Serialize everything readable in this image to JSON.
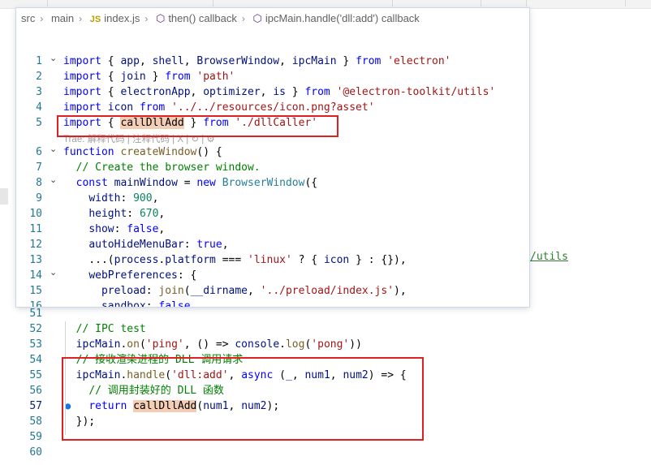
{
  "breadcrumb": {
    "items": [
      "src",
      "main",
      "index.js",
      "then() callback",
      "ipcMain.handle('dll:add') callback"
    ],
    "file_icon": "JS"
  },
  "hover_lines": [
    {
      "num": "1",
      "fold": true,
      "tokens": [
        [
          "k",
          "import"
        ],
        [
          "p",
          " { "
        ],
        [
          "v",
          "app"
        ],
        [
          "p",
          ", "
        ],
        [
          "v",
          "shell"
        ],
        [
          "p",
          ", "
        ],
        [
          "v",
          "BrowserWindow"
        ],
        [
          "p",
          ", "
        ],
        [
          "v",
          "ipcMain"
        ],
        [
          "p",
          " } "
        ],
        [
          "k",
          "from"
        ],
        [
          "p",
          " "
        ],
        [
          "s",
          "'electron'"
        ]
      ]
    },
    {
      "num": "2",
      "fold": false,
      "tokens": [
        [
          "k",
          "import"
        ],
        [
          "p",
          " { "
        ],
        [
          "v",
          "join"
        ],
        [
          "p",
          " } "
        ],
        [
          "k",
          "from"
        ],
        [
          "p",
          " "
        ],
        [
          "s",
          "'path'"
        ]
      ]
    },
    {
      "num": "3",
      "fold": false,
      "tokens": [
        [
          "k",
          "import"
        ],
        [
          "p",
          " { "
        ],
        [
          "v",
          "electronApp"
        ],
        [
          "p",
          ", "
        ],
        [
          "v",
          "optimizer"
        ],
        [
          "p",
          ", "
        ],
        [
          "v",
          "is"
        ],
        [
          "p",
          " } "
        ],
        [
          "k",
          "from"
        ],
        [
          "p",
          " "
        ],
        [
          "s",
          "'@electron-toolkit/utils'"
        ]
      ]
    },
    {
      "num": "4",
      "fold": false,
      "tokens": [
        [
          "k",
          "import"
        ],
        [
          "p",
          " "
        ],
        [
          "v",
          "icon"
        ],
        [
          "p",
          " "
        ],
        [
          "k",
          "from"
        ],
        [
          "p",
          " "
        ],
        [
          "s",
          "'../../resources/icon.png?asset'"
        ]
      ]
    },
    {
      "num": "5",
      "fold": false,
      "tokens": [
        [
          "k",
          "import"
        ],
        [
          "p",
          " { "
        ],
        [
          "hl",
          "callDllAdd"
        ],
        [
          "p",
          " } "
        ],
        [
          "k",
          "from"
        ],
        [
          "p",
          " "
        ],
        [
          "s",
          "'./dllCaller'"
        ]
      ]
    },
    {
      "num": "6",
      "fold": true,
      "tokens": [
        [
          "k",
          "function"
        ],
        [
          "p",
          " "
        ],
        [
          "f",
          "createWindow"
        ],
        [
          "p",
          "() {"
        ]
      ]
    },
    {
      "num": "7",
      "fold": false,
      "tokens": [
        [
          "p",
          "  "
        ],
        [
          "c",
          "// Create the browser window."
        ]
      ]
    },
    {
      "num": "8",
      "fold": true,
      "tokens": [
        [
          "p",
          "  "
        ],
        [
          "k",
          "const"
        ],
        [
          "p",
          " "
        ],
        [
          "v",
          "mainWindow"
        ],
        [
          "p",
          " = "
        ],
        [
          "k",
          "new"
        ],
        [
          "p",
          " "
        ],
        [
          "t",
          "BrowserWindow"
        ],
        [
          "p",
          "({"
        ]
      ]
    },
    {
      "num": "9",
      "fold": false,
      "tokens": [
        [
          "p",
          "    "
        ],
        [
          "v",
          "width"
        ],
        [
          "p",
          ": "
        ],
        [
          "n",
          "900"
        ],
        [
          "p",
          ","
        ]
      ]
    },
    {
      "num": "10",
      "fold": false,
      "tokens": [
        [
          "p",
          "    "
        ],
        [
          "v",
          "height"
        ],
        [
          "p",
          ": "
        ],
        [
          "n",
          "670"
        ],
        [
          "p",
          ","
        ]
      ]
    },
    {
      "num": "11",
      "fold": false,
      "tokens": [
        [
          "p",
          "    "
        ],
        [
          "v",
          "show"
        ],
        [
          "p",
          ": "
        ],
        [
          "k",
          "false"
        ],
        [
          "p",
          ","
        ]
      ]
    },
    {
      "num": "12",
      "fold": false,
      "tokens": [
        [
          "p",
          "    "
        ],
        [
          "v",
          "autoHideMenuBar"
        ],
        [
          "p",
          ": "
        ],
        [
          "k",
          "true"
        ],
        [
          "p",
          ","
        ]
      ]
    },
    {
      "num": "13",
      "fold": false,
      "tokens": [
        [
          "p",
          "    ...("
        ],
        [
          "v",
          "process"
        ],
        [
          "p",
          "."
        ],
        [
          "v",
          "platform"
        ],
        [
          "p",
          " === "
        ],
        [
          "s",
          "'linux'"
        ],
        [
          "p",
          " ? { "
        ],
        [
          "v",
          "icon"
        ],
        [
          "p",
          " } : {}),"
        ]
      ]
    },
    {
      "num": "14",
      "fold": true,
      "tokens": [
        [
          "p",
          "    "
        ],
        [
          "v",
          "webPreferences"
        ],
        [
          "p",
          ": {"
        ]
      ]
    },
    {
      "num": "15",
      "fold": false,
      "tokens": [
        [
          "p",
          "      "
        ],
        [
          "v",
          "preload"
        ],
        [
          "p",
          ": "
        ],
        [
          "f",
          "join"
        ],
        [
          "p",
          "("
        ],
        [
          "v",
          "__dirname"
        ],
        [
          "p",
          ", "
        ],
        [
          "s",
          "'../preload/index.js'"
        ],
        [
          "p",
          "),"
        ]
      ]
    },
    {
      "num": "16",
      "fold": false,
      "tokens": [
        [
          "p",
          "      "
        ],
        [
          "v",
          "sandbox"
        ],
        [
          "p",
          ": "
        ],
        [
          "k",
          "false"
        ]
      ]
    }
  ],
  "inlay_hint": "Trae: 解释代码 | 注释代码 | X | ↻ | ⚙",
  "main_lines": [
    {
      "num": "51",
      "tokens": []
    },
    {
      "num": "52",
      "tokens": [
        [
          "p",
          "  "
        ],
        [
          "c",
          "// IPC test"
        ]
      ]
    },
    {
      "num": "53",
      "tokens": [
        [
          "p",
          "  "
        ],
        [
          "v",
          "ipcMain"
        ],
        [
          "p",
          "."
        ],
        [
          "f",
          "on"
        ],
        [
          "p",
          "("
        ],
        [
          "s",
          "'ping'"
        ],
        [
          "p",
          ", () => "
        ],
        [
          "v",
          "console"
        ],
        [
          "p",
          "."
        ],
        [
          "f",
          "log"
        ],
        [
          "p",
          "("
        ],
        [
          "s",
          "'pong'"
        ],
        [
          "p",
          "))"
        ]
      ]
    },
    {
      "num": "54",
      "tokens": [
        [
          "p",
          "  "
        ],
        [
          "c",
          "// 接收渲染进程的 DLL 调用请求"
        ]
      ]
    },
    {
      "num": "55",
      "tokens": [
        [
          "p",
          "  "
        ],
        [
          "v",
          "ipcMain"
        ],
        [
          "p",
          "."
        ],
        [
          "f",
          "handle"
        ],
        [
          "p",
          "("
        ],
        [
          "s",
          "'dll:add'"
        ],
        [
          "p",
          ", "
        ],
        [
          "k",
          "async"
        ],
        [
          "p",
          " ("
        ],
        [
          "v",
          "_"
        ],
        [
          "p",
          ", "
        ],
        [
          "v",
          "num1"
        ],
        [
          "p",
          ", "
        ],
        [
          "v",
          "num2"
        ],
        [
          "p",
          ") => {"
        ]
      ]
    },
    {
      "num": "56",
      "tokens": [
        [
          "p",
          "    "
        ],
        [
          "c",
          "// 调用封装好的 DLL 函数"
        ]
      ]
    },
    {
      "num": "57",
      "tokens": [
        [
          "p",
          "    "
        ],
        [
          "k",
          "return"
        ],
        [
          "p",
          " "
        ],
        [
          "hl",
          "callDllAdd"
        ],
        [
          "p",
          "("
        ],
        [
          "v",
          "num1"
        ],
        [
          "p",
          ", "
        ],
        [
          "v",
          "num2"
        ],
        [
          "p",
          ");"
        ]
      ]
    },
    {
      "num": "58",
      "tokens": [
        [
          "p",
          "  });"
        ]
      ]
    },
    {
      "num": "59",
      "tokens": []
    },
    {
      "num": "60",
      "tokens": []
    }
  ],
  "side_text": "/utils",
  "colors": {
    "keyword": "#0000ff",
    "comment": "#008000",
    "string": "#a31515",
    "highlight": "#f4cdb5",
    "annotation_box": "#e02020"
  }
}
